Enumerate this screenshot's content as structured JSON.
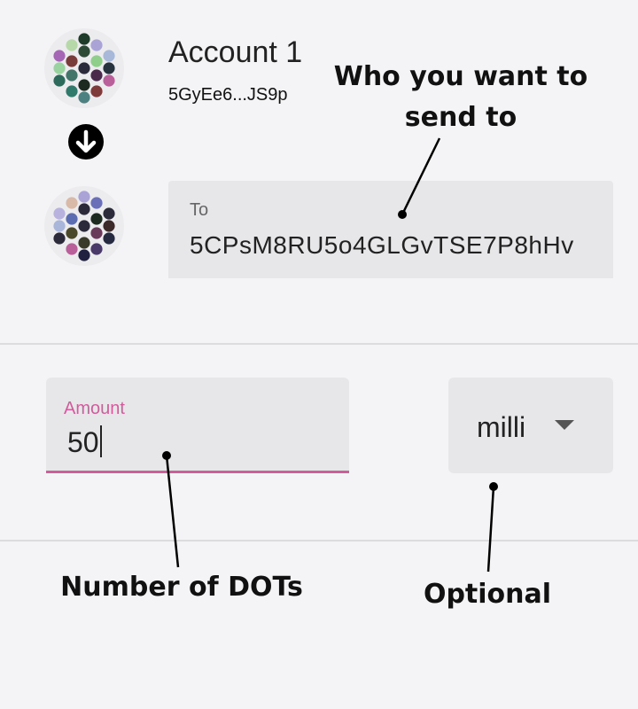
{
  "from_account": {
    "name": "Account 1",
    "address": "5GyEe6...JS9p",
    "icon": "identicon"
  },
  "direction_icon": "arrow-down-circle-icon",
  "to_field": {
    "label": "To",
    "value": "5CPsM8RU5o4GLGvTSE7P8hHv"
  },
  "amount_field": {
    "label": "Amount",
    "value": "50"
  },
  "unit_select": {
    "selected": "milli"
  },
  "annotations": {
    "recipient": "Who you want to send to",
    "amount": "Number of DOTs",
    "unit": "Optional"
  },
  "colors": {
    "accent": "#d35b9c",
    "field_bg": "#e7e7ea",
    "page_bg": "#f4f4f6"
  }
}
